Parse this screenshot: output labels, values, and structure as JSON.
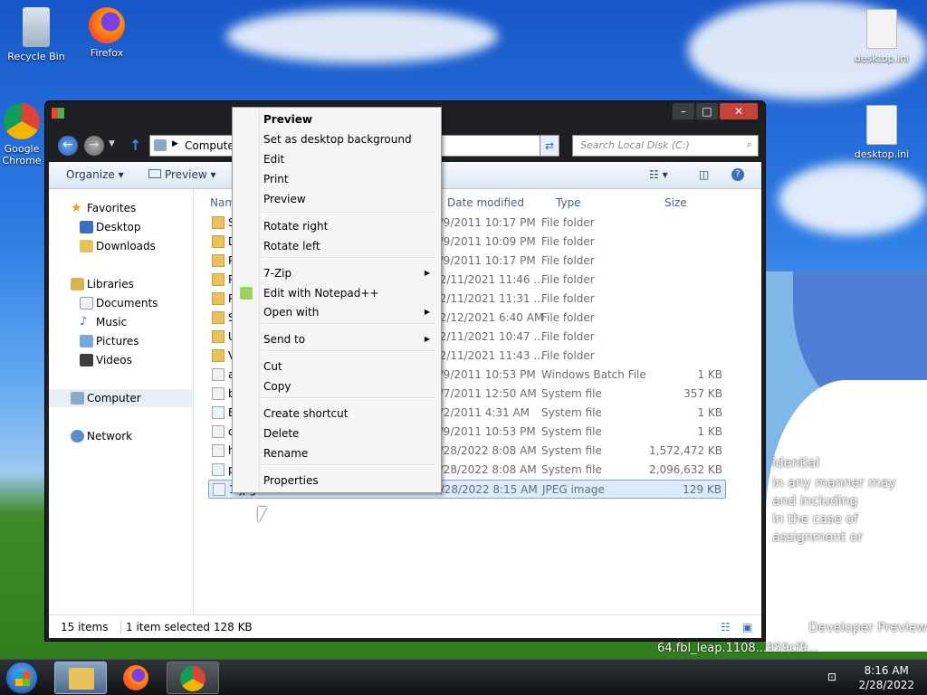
{
  "desktop": {
    "icons": [
      {
        "label": "Recycle Bin"
      },
      {
        "label": "Firefox"
      },
      {
        "label": "Google Chrome"
      },
      {
        "label": "desktop.ini"
      },
      {
        "label": "desktop.ini"
      }
    ],
    "watermark": {
      "line1": "idential",
      "line2": "in any manner may",
      "line3": "and including",
      "line4": "in the case of",
      "line5": "assignment or",
      "line6": "Developer Preview",
      "line7": "64.fbl_leap.1108...959cf9..."
    }
  },
  "window": {
    "address": {
      "crumb": "Computer"
    },
    "search": {
      "placeholder": "Search Local Disk (C:)"
    },
    "toolbar": {
      "organize": "Organize",
      "preview": "Preview"
    },
    "nav": {
      "favorites": "Favorites",
      "desktop": "Desktop",
      "downloads": "Downloads",
      "libraries": "Libraries",
      "documents": "Documents",
      "music": "Music",
      "pictures": "Pictures",
      "videos": "Videos",
      "computer": "Computer",
      "network": "Network"
    },
    "columns": {
      "name": "Name",
      "date": "Date modified",
      "type": "Type",
      "size": "Size"
    },
    "rows": [
      {
        "name": "S",
        "date": "8/9/2011 10:17 PM",
        "type": "File folder",
        "size": ""
      },
      {
        "name": "D",
        "date": "8/9/2011 10:09 PM",
        "type": "File folder",
        "size": ""
      },
      {
        "name": "P",
        "date": "8/9/2011 10:17 PM",
        "type": "File folder",
        "size": ""
      },
      {
        "name": "P",
        "date": "12/11/2021 11:46 ...",
        "type": "File folder",
        "size": ""
      },
      {
        "name": "P",
        "date": "12/11/2021 11:31 ...",
        "type": "File folder",
        "size": ""
      },
      {
        "name": "S",
        "date": "12/12/2021 6:40 AM",
        "type": "File folder",
        "size": ""
      },
      {
        "name": "U",
        "date": "12/11/2021 10:47 ...",
        "type": "File folder",
        "size": ""
      },
      {
        "name": "V",
        "date": "12/11/2021 11:43 ...",
        "type": "File folder",
        "size": ""
      },
      {
        "name": "a",
        "date": "8/9/2011 10:53 PM",
        "type": "Windows Batch File",
        "size": "1 KB"
      },
      {
        "name": "b",
        "date": "8/7/2011 12:50 AM",
        "type": "System file",
        "size": "357 KB"
      },
      {
        "name": "B",
        "date": "7/2/2011 4:31 AM",
        "type": "System file",
        "size": "1 KB"
      },
      {
        "name": "c",
        "date": "8/9/2011 10:53 PM",
        "type": "System file",
        "size": "1 KB"
      },
      {
        "name": "h",
        "date": "2/28/2022 8:08 AM",
        "type": "System file",
        "size": "1,572,472 KB"
      },
      {
        "name": "p",
        "date": "2/28/2022 8:08 AM",
        "type": "System file",
        "size": "2,096,632 KB"
      },
      {
        "name": "1.jpg",
        "date": "2/28/2022 8:15 AM",
        "type": "JPEG image",
        "size": "129 KB"
      }
    ],
    "status": {
      "count": "15 items",
      "selection": "1 item selected  128 KB"
    }
  },
  "context_menu": {
    "items": [
      {
        "label": "Preview"
      },
      {
        "label": "Set as desktop background"
      },
      {
        "label": "Edit"
      },
      {
        "label": "Print"
      },
      {
        "label": "Preview"
      },
      {
        "label": "Rotate right"
      },
      {
        "label": "Rotate left"
      },
      {
        "label": "7-Zip"
      },
      {
        "label": "Edit with Notepad++"
      },
      {
        "label": "Open with"
      },
      {
        "label": "Send to"
      },
      {
        "label": "Cut"
      },
      {
        "label": "Copy"
      },
      {
        "label": "Create shortcut"
      },
      {
        "label": "Delete"
      },
      {
        "label": "Rename"
      },
      {
        "label": "Properties"
      }
    ]
  },
  "taskbar": {
    "time": "8:16 AM",
    "date": "2/28/2022"
  },
  "colors": {
    "accent": "#1e395b",
    "selection": "#dcebfc"
  }
}
